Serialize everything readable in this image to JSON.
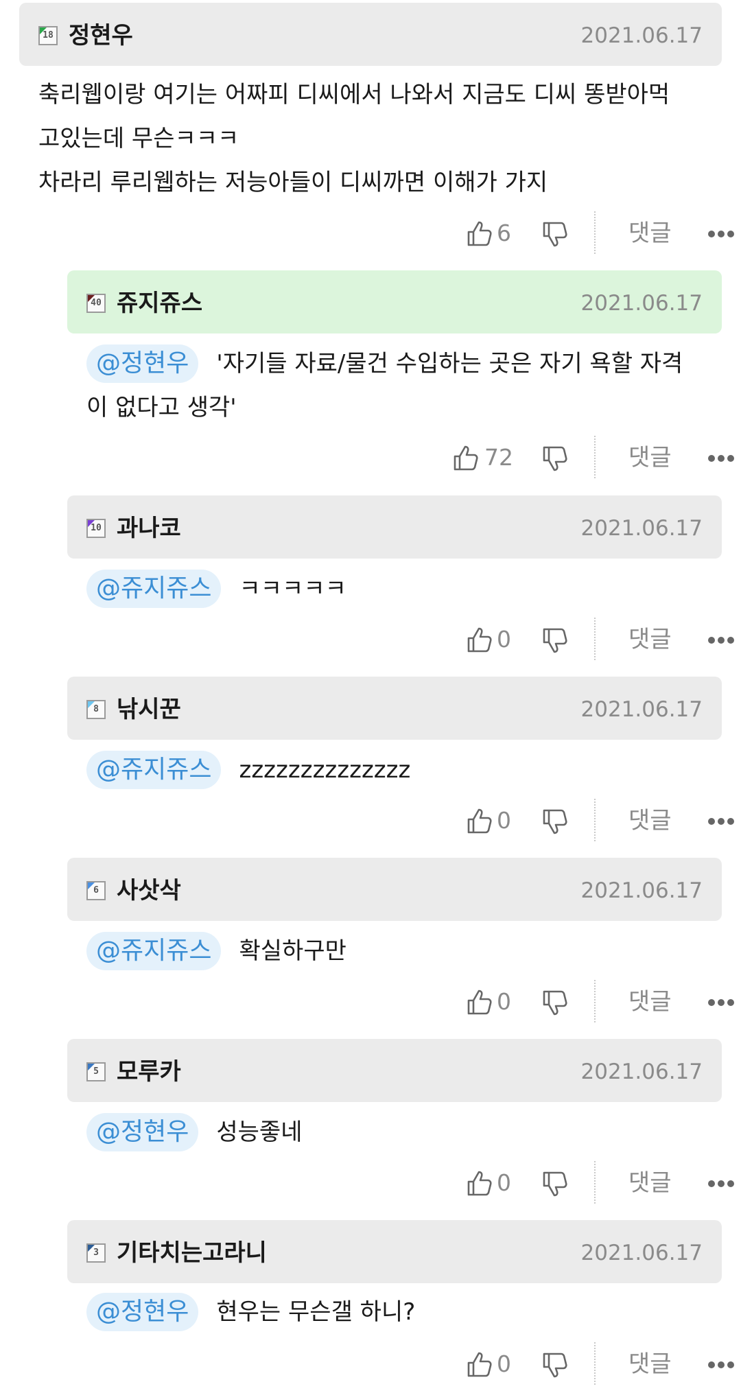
{
  "comments": [
    {
      "level": "18",
      "level_color": "#2aa84a",
      "author": "정현우",
      "date": "2021.06.17",
      "lines": [
        "축리웹이랑 여기는 어짜피 디씨에서 나와서 지금도 디씨 똥받아먹",
        "고있는데 무슨ㅋㅋㅋ",
        "차라리 루리웹하는 저능아들이 디씨까면 이해가 가지"
      ],
      "likes": "6",
      "reply_label": "댓글"
    },
    {
      "level": "40",
      "level_color": "#6b1f1f",
      "author": "쥬지쥬스",
      "date": "2021.06.17",
      "mention": "@정현우",
      "text": "'자기들 자료/물건 수입하는 곳은 자기 욕할 자격",
      "text_cont": "이 없다고 생각'",
      "likes": "72",
      "reply_label": "댓글"
    },
    {
      "level": "10",
      "level_color": "#7a3fd6",
      "author": "과나코",
      "date": "2021.06.17",
      "mention": "@쥬지쥬스",
      "text": "ㅋㅋㅋㅋㅋ",
      "likes": "0",
      "reply_label": "댓글"
    },
    {
      "level": "8",
      "level_color": "#6ec6f0",
      "author": "낚시꾼",
      "date": "2021.06.17",
      "mention": "@쥬지쥬스",
      "text": "zzzzzzzzzzzzzz",
      "likes": "0",
      "reply_label": "댓글"
    },
    {
      "level": "6",
      "level_color": "#4a90e2",
      "author": "사삿삭",
      "date": "2021.06.17",
      "mention": "@쥬지쥬스",
      "text": "확실하구만",
      "likes": "0",
      "reply_label": "댓글"
    },
    {
      "level": "5",
      "level_color": "#3a78c2",
      "author": "모루카",
      "date": "2021.06.17",
      "mention": "@정현우",
      "text": "성능좋네",
      "likes": "0",
      "reply_label": "댓글"
    },
    {
      "level": "3",
      "level_color": "#2c5d96",
      "author": "기타치는고라니",
      "date": "2021.06.17",
      "mention": "@정현우",
      "text": "현우는 무슨갤 하니?",
      "likes": "0",
      "reply_label": "댓글"
    }
  ]
}
